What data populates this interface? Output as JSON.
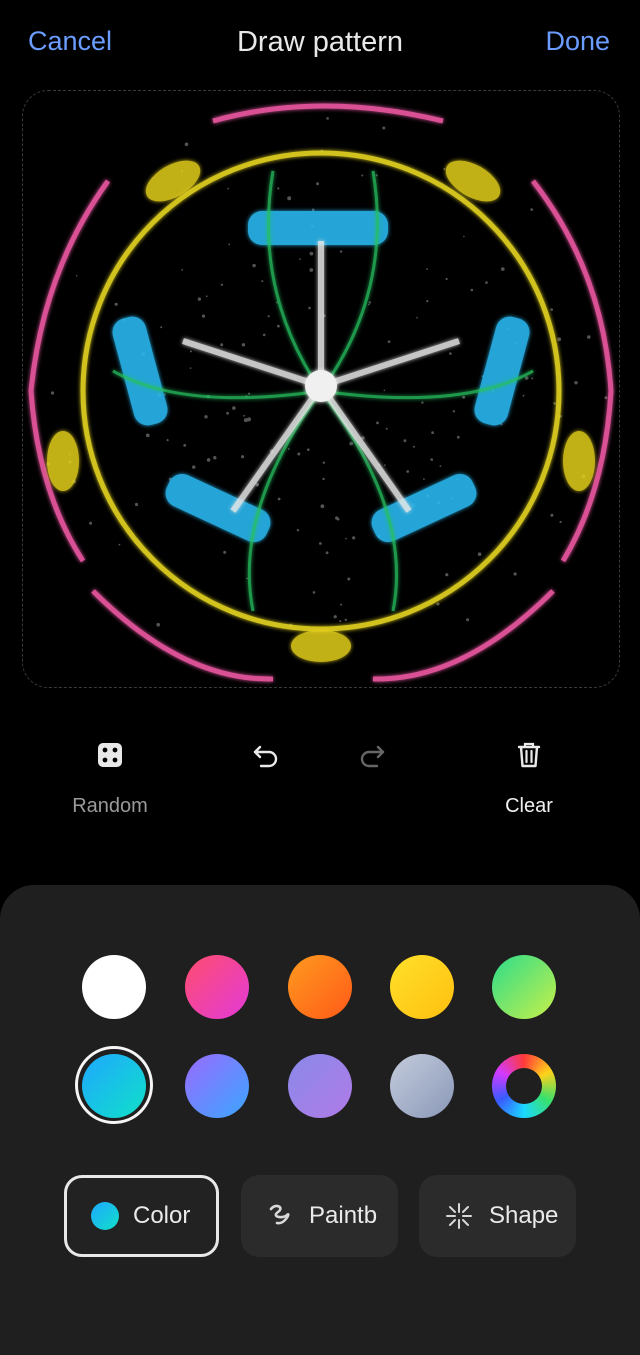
{
  "header": {
    "cancel": "Cancel",
    "title": "Draw pattern",
    "done": "Done"
  },
  "tools": {
    "random": "Random",
    "clear": "Clear"
  },
  "colors": {
    "accent": "#6b9cff",
    "row1": [
      "white",
      "pink-red",
      "orange",
      "yellow",
      "green"
    ],
    "row2": [
      "cyan",
      "blue-violet",
      "lavender",
      "gray-blue",
      "custom-wheel"
    ],
    "selected": "cyan"
  },
  "modes": {
    "color": "Color",
    "paintbrush": "Paintb",
    "shape": "Shape"
  },
  "icons": [
    "dice-icon",
    "undo-icon",
    "redo-icon",
    "trash-icon",
    "color-dot-icon",
    "brush-stroke-icon",
    "sparkle-shape-icon"
  ]
}
